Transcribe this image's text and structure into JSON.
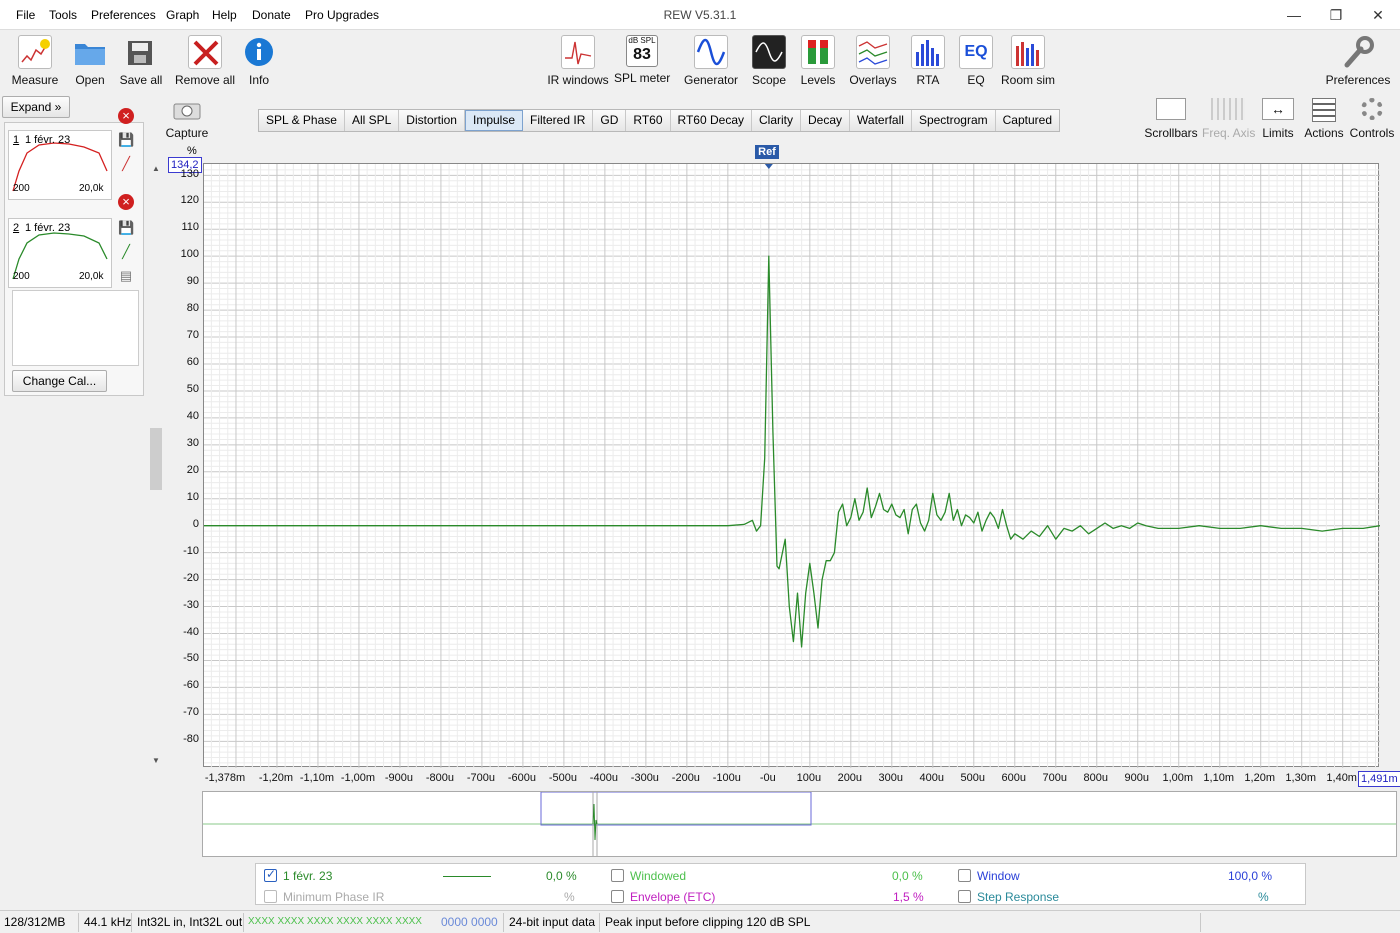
{
  "app": {
    "title": "REW V5.31.1"
  },
  "menu": [
    "File",
    "Tools",
    "Preferences",
    "Graph",
    "Help",
    "Donate",
    "Pro Upgrades"
  ],
  "toolbar_left": [
    "Measure",
    "Open",
    "Save all",
    "Remove all",
    "Info"
  ],
  "toolbar_center": [
    "IR windows",
    "SPL meter",
    "Generator",
    "Scope",
    "Levels",
    "Overlays",
    "RTA",
    "EQ",
    "Room sim"
  ],
  "spl_meter_icon": {
    "top": "dB SPL",
    "value": "83"
  },
  "eq_icon_text": "EQ",
  "preferences_label": "Preferences",
  "expand_label": "Expand",
  "capture_label": "Capture",
  "tabs": [
    "SPL & Phase",
    "All SPL",
    "Distortion",
    "Impulse",
    "Filtered IR",
    "GD",
    "RT60",
    "RT60 Decay",
    "Clarity",
    "Decay",
    "Waterfall",
    "Spectrogram",
    "Captured"
  ],
  "active_tab": "Impulse",
  "right_toolbar": [
    "Scrollbars",
    "Freq. Axis",
    "Limits",
    "Actions",
    "Controls"
  ],
  "measurements": [
    {
      "num": "1",
      "name": "1 févr. 23",
      "xstart": "200",
      "xend": "20,0k",
      "color": "#d42020"
    },
    {
      "num": "2",
      "name": "1 févr. 23",
      "xstart": "200",
      "xend": "20,0k",
      "color": "#2a8a2a"
    }
  ],
  "change_cal_label": "Change Cal...",
  "graph": {
    "y_unit": "%",
    "y_top_box": "134,2",
    "y_partial_top": "130",
    "ref_label": "Ref",
    "x_end_box": "1,491m"
  },
  "chart_data": {
    "type": "line",
    "title": "",
    "xlabel": "",
    "ylabel": "%",
    "xlim": [
      -1.378,
      1.491
    ],
    "x_unit": "ms",
    "ylim": [
      -89.9,
      134.2
    ],
    "yticks": [
      "120",
      "110",
      "100",
      "90",
      "80",
      "70",
      "60",
      "50",
      "40",
      "30",
      "20",
      "10",
      "0",
      "-10",
      "-20",
      "-30",
      "-40",
      "-50",
      "-60",
      "-70",
      "-80"
    ],
    "xticks": [
      "-1,378m",
      "-1,20m",
      "-1,10m",
      "-1,00m",
      "-900u",
      "-800u",
      "-700u",
      "-600u",
      "-500u",
      "-400u",
      "-300u",
      "-200u",
      "-100u",
      "-0u",
      "100u",
      "200u",
      "300u",
      "400u",
      "500u",
      "600u",
      "700u",
      "800u",
      "900u",
      "1,00m",
      "1,10m",
      "1,20m",
      "1,30m",
      "1,40m"
    ],
    "grid": true,
    "series": [
      {
        "name": "1 févr. 23",
        "color": "#2a8a2a",
        "x": [
          -1.378,
          -0.2,
          -0.1,
          -0.06,
          -0.04,
          -0.03,
          -0.02,
          -0.01,
          0,
          0.01,
          0.02,
          0.025,
          0.04,
          0.05,
          0.06,
          0.07,
          0.08,
          0.09,
          0.1,
          0.11,
          0.12,
          0.13,
          0.14,
          0.15,
          0.16,
          0.17,
          0.18,
          0.19,
          0.2,
          0.21,
          0.22,
          0.23,
          0.24,
          0.25,
          0.26,
          0.27,
          0.28,
          0.29,
          0.3,
          0.31,
          0.32,
          0.33,
          0.34,
          0.35,
          0.36,
          0.37,
          0.38,
          0.39,
          0.4,
          0.41,
          0.42,
          0.43,
          0.44,
          0.45,
          0.46,
          0.47,
          0.48,
          0.49,
          0.5,
          0.51,
          0.52,
          0.53,
          0.54,
          0.55,
          0.56,
          0.57,
          0.58,
          0.59,
          0.6,
          0.62,
          0.64,
          0.66,
          0.68,
          0.7,
          0.72,
          0.74,
          0.76,
          0.78,
          0.8,
          0.82,
          0.84,
          0.86,
          0.88,
          0.9,
          0.92,
          0.95,
          1.0,
          1.05,
          1.1,
          1.15,
          1.2,
          1.25,
          1.3,
          1.35,
          1.4,
          1.45,
          1.491
        ],
        "y": [
          0,
          0,
          0,
          0.5,
          2,
          -2,
          0,
          25,
          100,
          35,
          -15,
          -16,
          -5,
          -30,
          -43,
          -25,
          -45,
          -25,
          -14,
          -25,
          -38,
          -20,
          -13,
          -13,
          -10,
          5,
          8,
          0,
          3,
          10,
          2,
          5,
          14,
          3,
          7,
          12,
          6,
          5,
          8,
          4,
          3,
          6,
          -3,
          6,
          8,
          1,
          -2,
          2,
          12,
          4,
          2,
          5,
          12,
          2,
          6,
          0,
          4,
          3,
          1,
          5,
          -2,
          2,
          5,
          3,
          -1,
          6,
          0,
          -5,
          -3,
          -5,
          -2,
          -4,
          0,
          -5,
          -1,
          -2,
          0,
          -3,
          -1,
          1,
          -1,
          0,
          -1,
          1,
          0,
          -1,
          -1,
          0,
          -1,
          -1,
          0,
          -1,
          -1,
          -2,
          -1,
          -1,
          0
        ]
      }
    ]
  },
  "legend": {
    "meas_name": "1 févr. 23",
    "meas_value": "0,0 %",
    "min_phase": "Minimum Phase IR",
    "min_phase_value": "%",
    "windowed": "Windowed",
    "windowed_value": "0,0 %",
    "envelope": "Envelope (ETC)",
    "envelope_value": "1,5 %",
    "window": "Window",
    "window_value": "100,0 %",
    "step": "Step Response",
    "step_value": "%"
  },
  "status": {
    "memory": "128/312MB",
    "rate": "44.1 kHz",
    "format": "Int32L in, Int32L out",
    "levels": "XXXX XXXX  XXXX XXXX  XXXX XXXX",
    "counter": "0000 0000",
    "input": "24-bit input data",
    "peak": "Peak input before clipping 120 dB SPL"
  }
}
